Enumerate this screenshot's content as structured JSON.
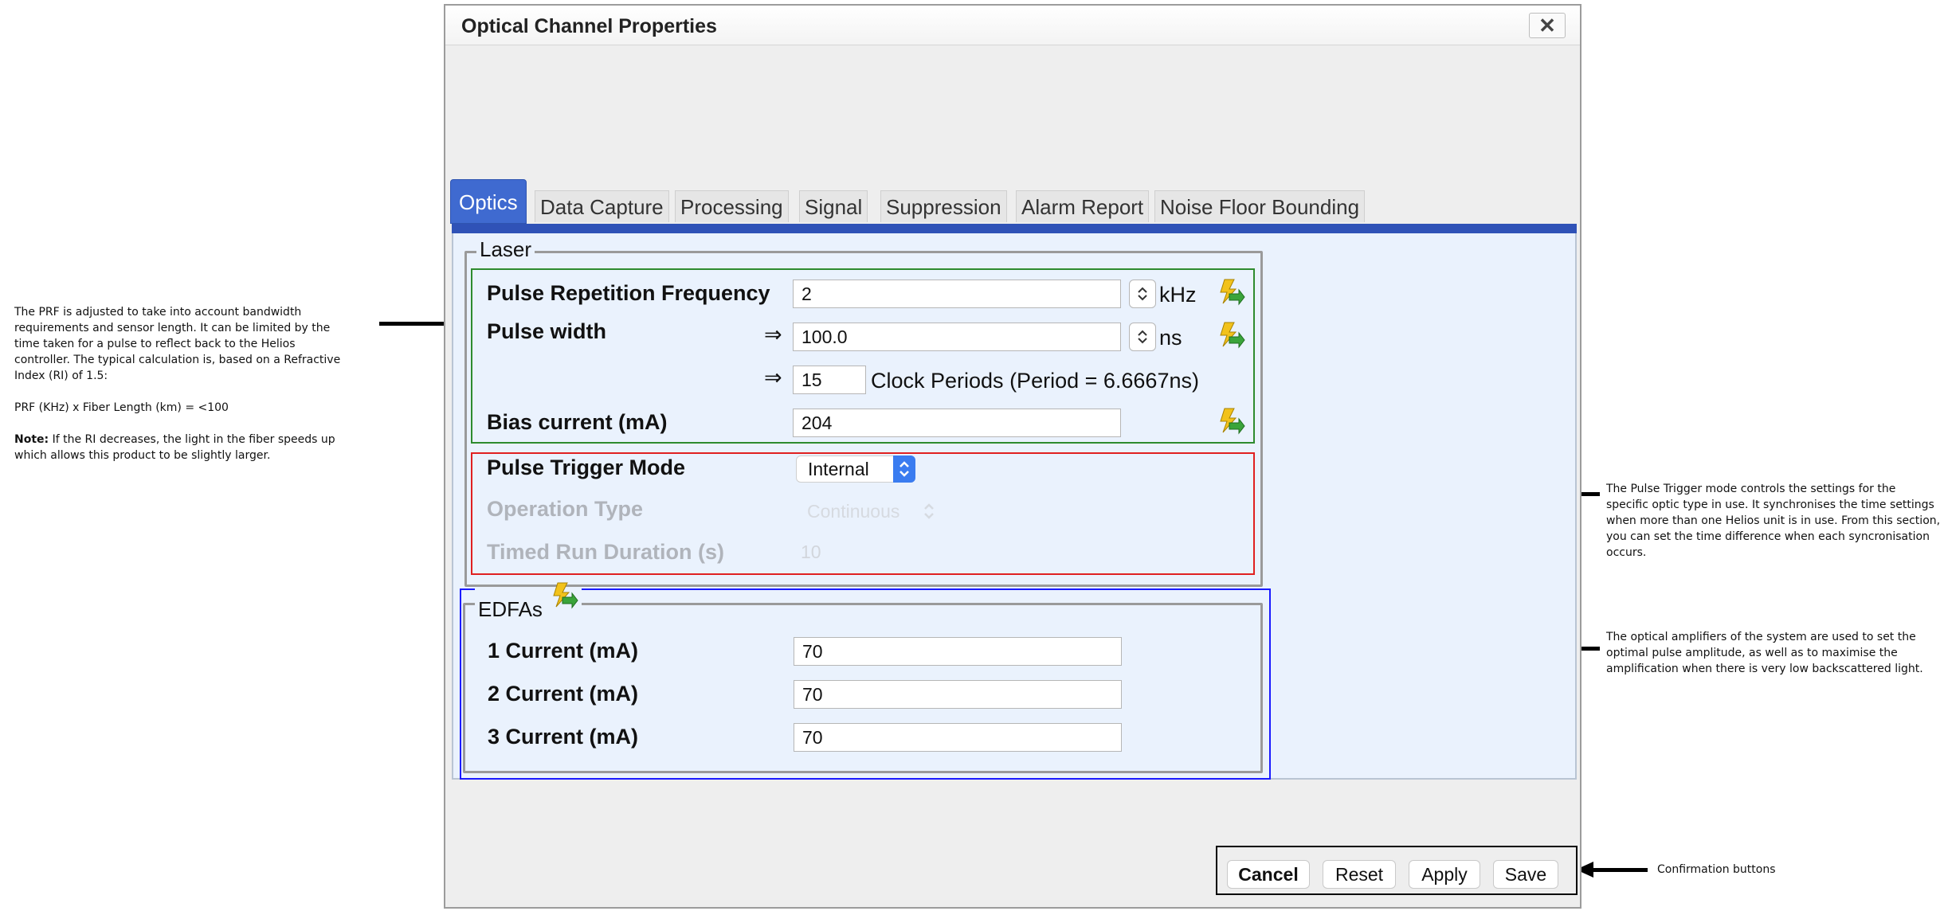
{
  "annotations": {
    "prf": {
      "para1": "The PRF is adjusted to take into account bandwidth requirements and sensor length. It can be limited by the time taken for a pulse to reflect back to the Helios controller. The typical calculation is, based on a Refractive Index (RI) of 1.5:",
      "formula": "PRF (KHz) x Fiber Length (km) = <100",
      "note_label": "Note:",
      "note_text": " If the RI decreases, the light in the fiber speeds up which allows this product to be slightly larger."
    },
    "trigger": "The Pulse Trigger mode controls the settings for the specific optic type in use. It synchronises the time settings when more than one Helios unit is in use. From this section, you can set the time difference when each syncronisation occurs.",
    "edfa": "The optical amplifiers of the system are used to set the optimal pulse amplitude, as well as to maximise the amplification when there is very low backscattered light.",
    "confirm": "Confirmation buttons"
  },
  "dialog": {
    "title": "Optical Channel Properties",
    "close_glyph": "✕"
  },
  "tabs": [
    "Optics",
    "Data Capture",
    "Processing",
    "Signal",
    "Suppression",
    "Alarm Report",
    "Noise Floor Bounding"
  ],
  "laser": {
    "legend": "Laser",
    "prf_label": "Pulse Repetition Frequency",
    "prf_value": "2",
    "prf_unit": "kHz",
    "pw_label": "Pulse width",
    "pw_value": "100.0",
    "pw_unit": "ns",
    "implies": "⇒",
    "clock_value": "15",
    "clock_text": "Clock Periods (Period = 6.6667ns)",
    "bias_label": "Bias current (mA)",
    "bias_value": "204",
    "trigger_label": "Pulse Trigger Mode",
    "trigger_value": "Internal",
    "optype_label": "Operation Type",
    "optype_value": "Continuous",
    "timed_label": "Timed Run Duration (s)",
    "timed_value": "10"
  },
  "edfa": {
    "legend": "EDFAs",
    "c1_label": "1 Current (mA)",
    "c1_value": "70",
    "c2_label": "2 Current (mA)",
    "c2_value": "70",
    "c3_label": "3 Current (mA)",
    "c3_value": "70"
  },
  "buttons": {
    "cancel": "Cancel",
    "reset": "Reset",
    "apply": "Apply",
    "save": "Save"
  },
  "colors": {
    "tab_active": "#3f6ad0",
    "laser_group": "#2e8b2e",
    "trigger_group": "#e02020",
    "edfa_group": "#1a1aff",
    "panel": "#eaf2fd"
  }
}
